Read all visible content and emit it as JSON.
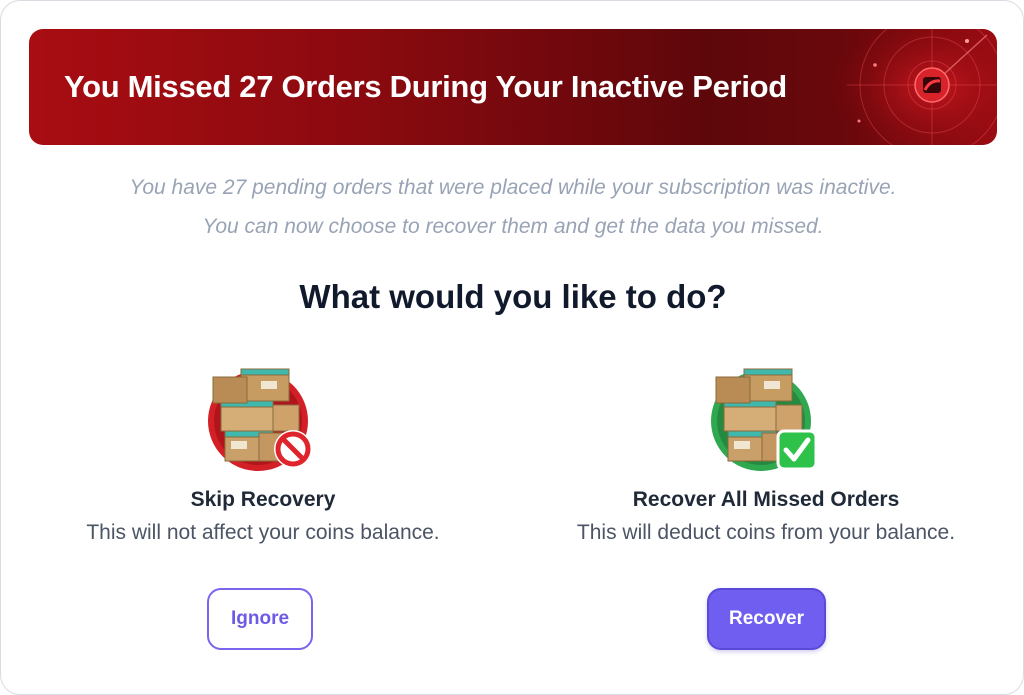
{
  "banner": {
    "title": "You Missed 27 Orders During Your Inactive Period",
    "icon": "radar-logo-icon",
    "accent_color": "#8a0a0f"
  },
  "message": {
    "line1": "You have 27 pending orders that were placed while your subscription was inactive.",
    "line2": "You can now choose to recover them and get the data you missed."
  },
  "question": "What would you like to do?",
  "options": {
    "skip": {
      "title": "Skip Recovery",
      "description": "This will not affect your coins balance.",
      "icon": "boxes-prohibited-icon",
      "button_label": "Ignore"
    },
    "recover": {
      "title": "Recover All Missed Orders",
      "description": "This will deduct coins from your balance.",
      "icon": "boxes-check-icon",
      "button_label": "Recover"
    }
  },
  "colors": {
    "primary": "#6f5ef0",
    "skip_ring": "#d31f26",
    "recover_ring": "#2fa84f"
  }
}
